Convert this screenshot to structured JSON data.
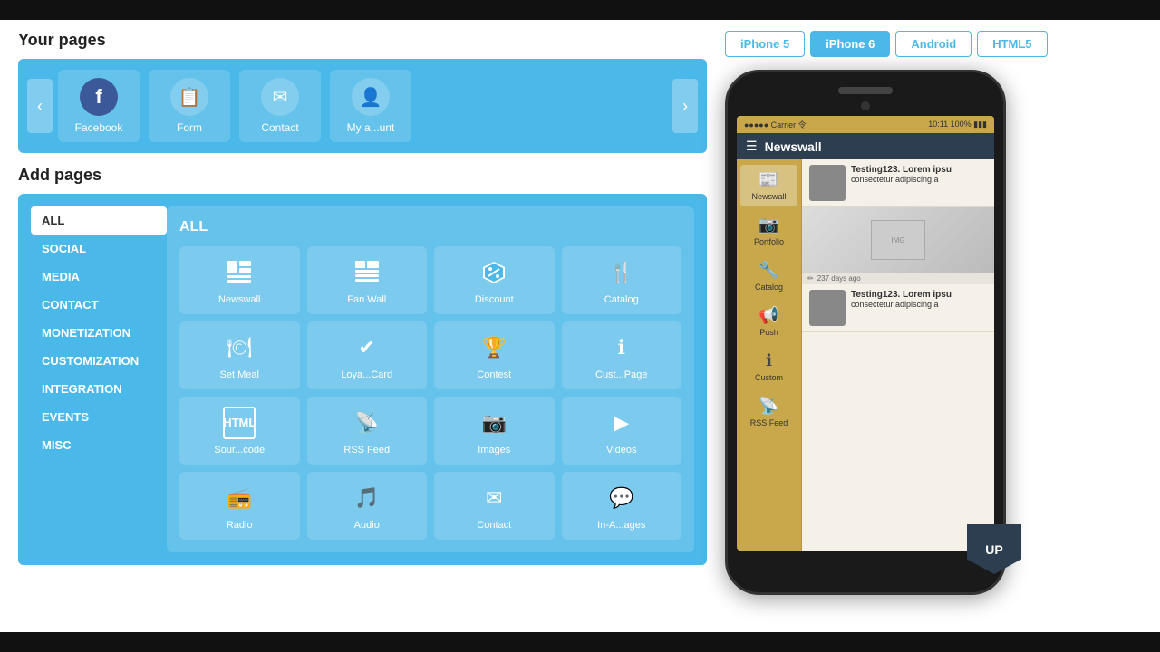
{
  "blackbars": {
    "top": true,
    "bottom": true
  },
  "left": {
    "your_pages_title": "Your pages",
    "add_pages_title": "Add pages",
    "your_pages": [
      {
        "label": "Facebook",
        "icon": "f"
      },
      {
        "label": "Form",
        "icon": "📋"
      },
      {
        "label": "Contact",
        "icon": "✉"
      },
      {
        "label": "My a...unt",
        "icon": "👤"
      }
    ],
    "categories": [
      {
        "label": "ALL",
        "active": true
      },
      {
        "label": "SOCIAL",
        "active": false
      },
      {
        "label": "MEDIA",
        "active": false
      },
      {
        "label": "CONTACT",
        "active": false
      },
      {
        "label": "MONETIZATION",
        "active": false
      },
      {
        "label": "CUSTOMIZATION",
        "active": false
      },
      {
        "label": "INTEGRATION",
        "active": false
      },
      {
        "label": "EVENTS",
        "active": false
      },
      {
        "label": "MISC",
        "active": false
      }
    ],
    "apps_grid_title": "ALL",
    "apps": [
      {
        "label": "Newswall",
        "icon": "📰"
      },
      {
        "label": "Fan Wall",
        "icon": "📋"
      },
      {
        "label": "Discount",
        "icon": "🔖"
      },
      {
        "label": "Catalog",
        "icon": "🍴"
      },
      {
        "label": "Set Meal",
        "icon": "🍽"
      },
      {
        "label": "Loya...Card",
        "icon": "✔"
      },
      {
        "label": "Contest",
        "icon": "🏆"
      },
      {
        "label": "Cust...Page",
        "icon": "ℹ"
      },
      {
        "label": "Sour...code",
        "icon": "📄"
      },
      {
        "label": "RSS Feed",
        "icon": "📡"
      },
      {
        "label": "Images",
        "icon": "📷"
      },
      {
        "label": "Videos",
        "icon": "▶"
      },
      {
        "label": "Radio",
        "icon": "📻"
      },
      {
        "label": "Audio",
        "icon": "🎵"
      },
      {
        "label": "Contact",
        "icon": "✉"
      },
      {
        "label": "In-A...ages",
        "icon": "💬"
      }
    ]
  },
  "right": {
    "device_tabs": [
      {
        "label": "iPhone 5",
        "active": false
      },
      {
        "label": "iPhone 6",
        "active": true
      },
      {
        "label": "Android",
        "active": false
      },
      {
        "label": "HTML5",
        "active": false
      }
    ],
    "phone": {
      "status_left": "●●●●● Carrier 令",
      "status_right": "10:11         100% ▮▮▮",
      "header_title": "Newswall",
      "sidebar_items": [
        {
          "label": "Newswall",
          "icon": "📰"
        },
        {
          "label": "Portfolio",
          "icon": "📷"
        },
        {
          "label": "Catalog",
          "icon": "🔧"
        },
        {
          "label": "Push",
          "icon": "📢"
        },
        {
          "label": "Custom",
          "icon": "ℹ"
        },
        {
          "label": "RSS Feed",
          "icon": "📡"
        }
      ],
      "content_items": [
        {
          "title": "Testing123. Lorem ipsu",
          "subtitle": "consectetur adipiscing a",
          "has_thumb": true
        },
        {
          "timestamp": "237 days ago",
          "has_large_img": true
        },
        {
          "title": "Testing123. Lorem ipsu",
          "subtitle": "consectetur adipiscing a",
          "has_thumb": true
        }
      ]
    }
  },
  "up_badge": "UP"
}
